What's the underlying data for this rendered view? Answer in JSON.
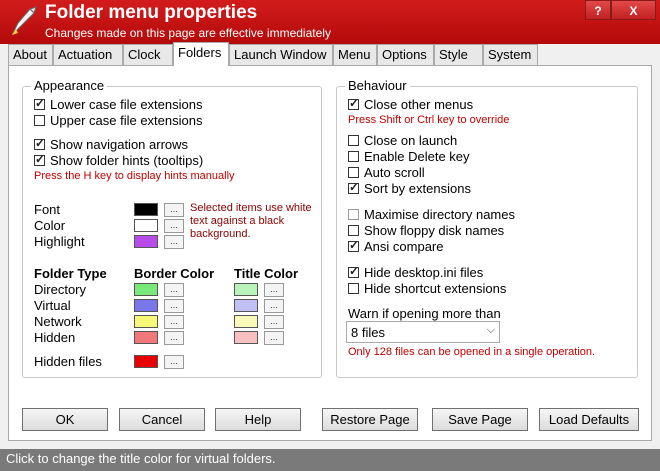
{
  "window": {
    "title": "Folder menu properties",
    "subtitle": "Changes made on this page are effective immediately",
    "help_label": "?",
    "close_label": "X",
    "accent_color": "#c81414"
  },
  "tabs": [
    "About",
    "Actuation",
    "Clock",
    "Folders",
    "Launch Window",
    "Menu",
    "Options",
    "Style",
    "System"
  ],
  "active_tab": "Folders",
  "appearance": {
    "legend": "Appearance",
    "options": [
      {
        "label": "Lower case file extensions",
        "checked": true
      },
      {
        "label": "Upper case file extensions",
        "checked": false
      },
      {
        "label": "Show navigation arrows",
        "checked": true
      },
      {
        "label": "Show folder hints (tooltips)",
        "checked": true
      }
    ],
    "hint_note": "Press the H key to display hints manually",
    "font_label": "Font",
    "color_label": "Color",
    "highlight_label": "Highlight",
    "font_color": "#000000",
    "text_color": "#ffffff",
    "highlight_color": "#b84ce8",
    "selected_note": [
      "Selected items use white",
      "text against a black",
      "background."
    ],
    "folder_type_header": "Folder Type",
    "border_color_header": "Border Color",
    "title_color_header": "Title Color",
    "folder_types": [
      {
        "name": "Directory",
        "border": "#78e878",
        "title": "#b8f4b8"
      },
      {
        "name": "Virtual",
        "border": "#7878e8",
        "title": "#c0c0f4"
      },
      {
        "name": "Network",
        "border": "#f8f878",
        "title": "#f8f8b8"
      },
      {
        "name": "Hidden",
        "border": "#f07878",
        "title": "#f8c0c0"
      }
    ],
    "hidden_files_label": "Hidden files",
    "hidden_files_color": "#e80000",
    "ellipsis": "..."
  },
  "behaviour": {
    "legend": "Behaviour",
    "close_other_menus": {
      "label": "Close other menus",
      "checked": true
    },
    "override_note": "Press Shift or Ctrl key to override",
    "options": [
      {
        "label": "Close on launch",
        "checked": false
      },
      {
        "label": "Enable Delete key",
        "checked": false
      },
      {
        "label": "Auto scroll",
        "checked": false
      },
      {
        "label": "Sort by extensions",
        "checked": true
      },
      {
        "label": "Maximise directory names",
        "checked": false
      },
      {
        "label": "Show floppy disk names",
        "checked": false
      },
      {
        "label": "Ansi compare",
        "checked": true
      },
      {
        "label": "Hide desktop.ini files",
        "checked": true
      },
      {
        "label": "Hide shortcut extensions",
        "checked": false
      }
    ],
    "warn_label": "Warn if opening more than",
    "warn_value": "8 files",
    "warn_note": "Only 128 files can be opened in a single operation."
  },
  "buttons": {
    "ok": "OK",
    "cancel": "Cancel",
    "help": "Help",
    "restore": "Restore Page",
    "save": "Save Page",
    "defaults": "Load Defaults"
  },
  "status": "Click to change the title color for virtual folders."
}
